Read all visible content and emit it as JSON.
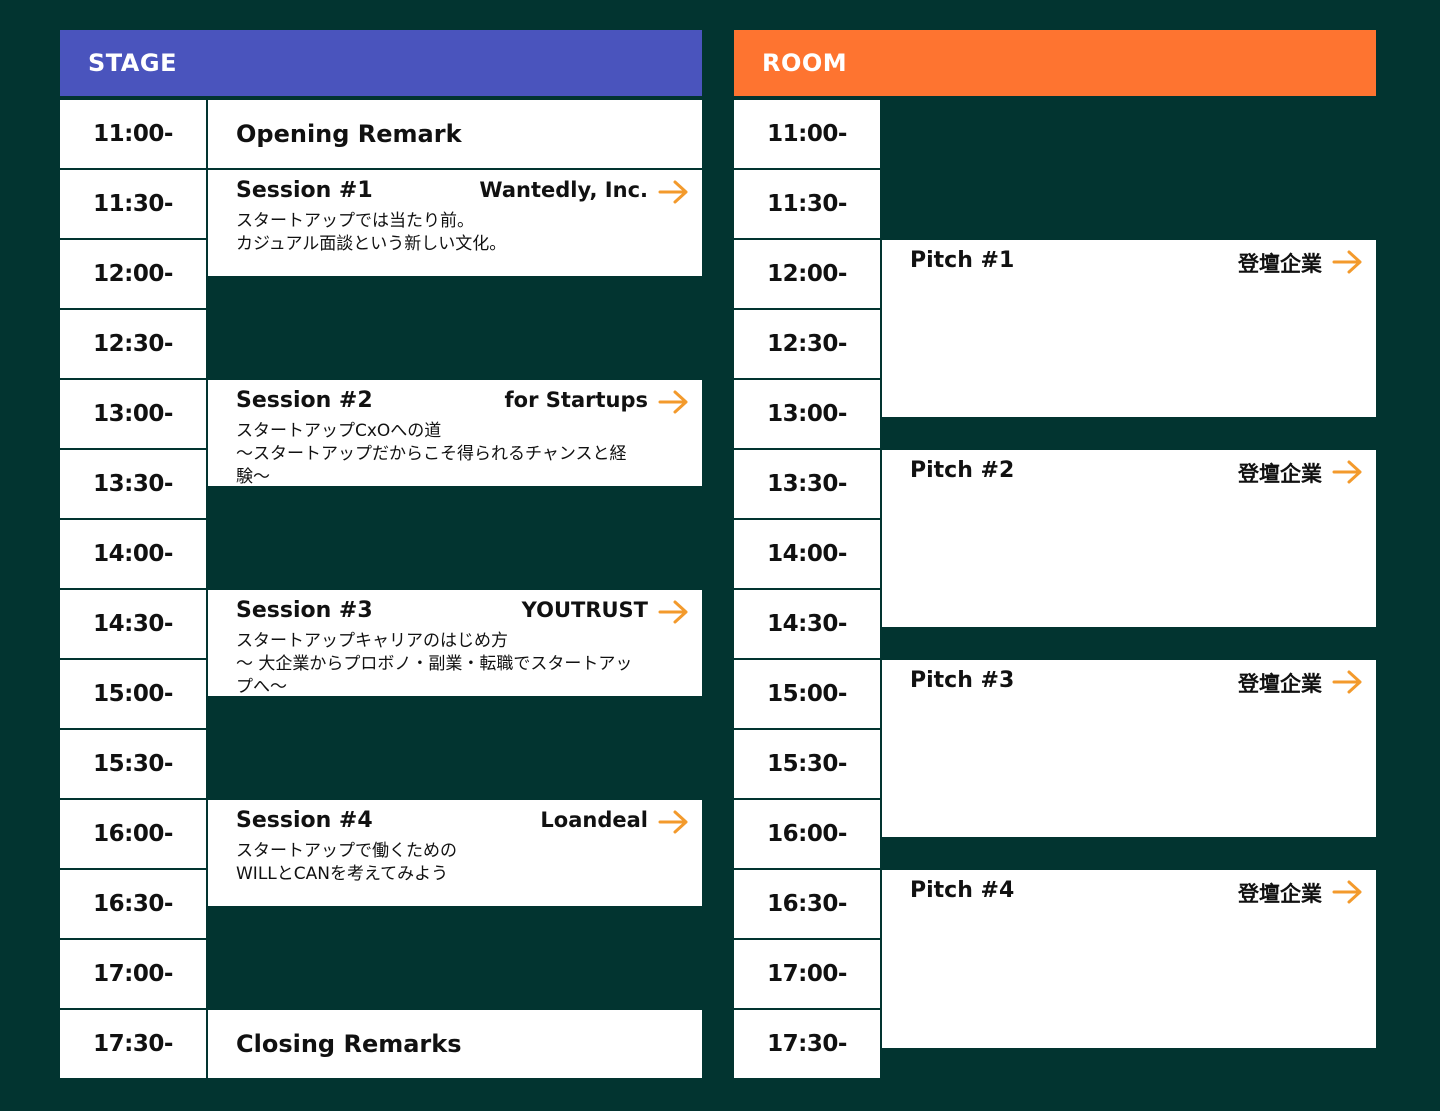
{
  "stage": {
    "header": "STAGE",
    "times": [
      "11:00-",
      "11:30-",
      "12:00-",
      "12:30-",
      "13:00-",
      "13:30-",
      "14:00-",
      "14:30-",
      "15:00-",
      "15:30-",
      "16:00-",
      "16:30-",
      "17:00-",
      "17:30-"
    ],
    "opening": "Opening Remark",
    "closing": "Closing Remarks",
    "sessions": [
      {
        "title": "Session #1",
        "company": "Wantedly, Inc.",
        "desc": [
          "スタートアップでは当たり前。",
          "カジュアル面談という新しい文化。"
        ]
      },
      {
        "title": "Session #2",
        "company": "for Startups",
        "desc": [
          "スタートアップCxOへの道",
          "〜スタートアップだからこそ得られるチャンスと経",
          "験〜"
        ]
      },
      {
        "title": "Session #3",
        "company": "YOUTRUST",
        "desc": [
          "スタートアップキャリアのはじめ方",
          "〜 大企業からプロボノ・副業・転職でスタートアッ",
          "プへ〜"
        ]
      },
      {
        "title": "Session #4",
        "company": "Loandeal",
        "desc": [
          "スタートアップで働くための",
          "WILLとCANを考えてみよう"
        ]
      }
    ]
  },
  "room": {
    "header": "ROOM",
    "times": [
      "11:00-",
      "11:30-",
      "12:00-",
      "12:30-",
      "13:00-",
      "13:30-",
      "14:00-",
      "14:30-",
      "15:00-",
      "15:30-",
      "16:00-",
      "16:30-",
      "17:00-",
      "17:30-"
    ],
    "pitches": [
      {
        "title": "Pitch #1",
        "company": "登壇企業"
      },
      {
        "title": "Pitch #2",
        "company": "登壇企業"
      },
      {
        "title": "Pitch #3",
        "company": "登壇企業"
      },
      {
        "title": "Pitch #4",
        "company": "登壇企業"
      }
    ]
  },
  "colors": {
    "background": "#023430",
    "stage_header": "#4a54bd",
    "room_header": "#fe7430",
    "arrow": "#f39a2c"
  },
  "icons": {
    "link_arrow": "arrow-right-icon"
  }
}
